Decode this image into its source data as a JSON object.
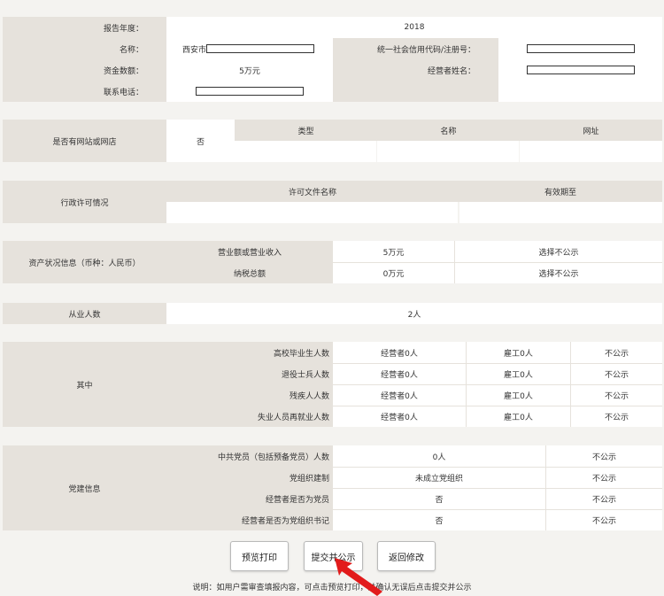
{
  "basic": {
    "year_label": "报告年度：",
    "year_value": "2018",
    "name_label": "名称：",
    "name_prefix": "西安市",
    "credit_code_label": "统一社会信用代码/注册号：",
    "capital_label": "资金数额：",
    "capital_value": "5万元",
    "operator_label": "经营者姓名：",
    "phone_label": "联系电话："
  },
  "website": {
    "label": "是否有网站或网店",
    "value": "否",
    "headers": [
      "类型",
      "名称",
      "网址"
    ]
  },
  "license": {
    "label": "行政许可情况",
    "headers": [
      "许可文件名称",
      "有效期至"
    ]
  },
  "assets": {
    "label": "资产状况信息（币种：人民币）",
    "rows": [
      {
        "label": "营业额或营业收入",
        "value": "5万元",
        "disclosure": "选择不公示"
      },
      {
        "label": "纳税总额",
        "value": "0万元",
        "disclosure": "选择不公示"
      }
    ]
  },
  "employees": {
    "label": "从业人数",
    "value": "2人"
  },
  "of_which": {
    "label": "其中",
    "rows": [
      {
        "label": "高校毕业生人数",
        "operator": "经营者0人",
        "employee": "雇工0人",
        "disclosure": "不公示"
      },
      {
        "label": "退役士兵人数",
        "operator": "经营者0人",
        "employee": "雇工0人",
        "disclosure": "不公示"
      },
      {
        "label": "残疾人人数",
        "operator": "经营者0人",
        "employee": "雇工0人",
        "disclosure": "不公示"
      },
      {
        "label": "失业人员再就业人数",
        "operator": "经营者0人",
        "employee": "雇工0人",
        "disclosure": "不公示"
      }
    ]
  },
  "party": {
    "label": "党建信息",
    "rows": [
      {
        "label": "中共党员（包括预备党员）人数",
        "value": "0人",
        "disclosure": "不公示"
      },
      {
        "label": "党组织建制",
        "value": "未成立党组织",
        "disclosure": "不公示"
      },
      {
        "label": "经营者是否为党员",
        "value": "否",
        "disclosure": "不公示"
      },
      {
        "label": "经营者是否为党组织书记",
        "value": "否",
        "disclosure": "不公示"
      }
    ]
  },
  "buttons": {
    "preview": "预览打印",
    "submit": "提交并公示",
    "back": "返回修改"
  },
  "note": "说明：如用户需审查填报内容，可点击预览打印，并确认无误后点击提交并公示",
  "colors": {
    "label_bg": "#e6e2dc",
    "value_bg": "#ffffff",
    "page_bg": "#f4f3f0",
    "arrow": "#e21b1b"
  }
}
